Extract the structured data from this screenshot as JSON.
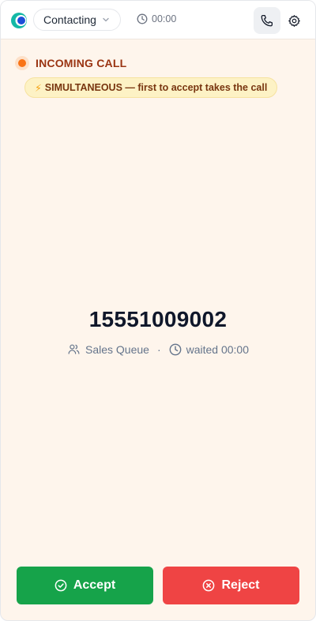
{
  "header": {
    "logo_icon": "app-logo-icon",
    "status": {
      "label": "Contacting",
      "icon": "chevron-down-icon"
    },
    "timer": {
      "icon": "clock-icon",
      "value": "00:00"
    },
    "phone_button": {
      "icon": "phone-icon"
    },
    "settings_button": {
      "icon": "gear-icon"
    }
  },
  "incoming": {
    "label": "INCOMING CALL",
    "indicator_color": "#f97316",
    "mode_badge": {
      "icon": "lightning-bolt",
      "bolt": "⚡",
      "text": "SIMULTANEOUS — first to accept takes the call"
    }
  },
  "caller": {
    "number": "15551009002",
    "queue_icon": "users-icon",
    "queue": "Sales Queue",
    "separator": "·",
    "wait_icon": "clock-icon",
    "waited": "waited 00:00"
  },
  "actions": {
    "accept": {
      "label": "Accept",
      "icon": "check-circle-icon",
      "color": "#16a34a"
    },
    "reject": {
      "label": "Reject",
      "icon": "x-circle-icon",
      "color": "#ef4444"
    }
  },
  "colors": {
    "background": "#fef5ec",
    "accent_text": "#9a3412",
    "badge_bg": "#fdf2c5"
  }
}
